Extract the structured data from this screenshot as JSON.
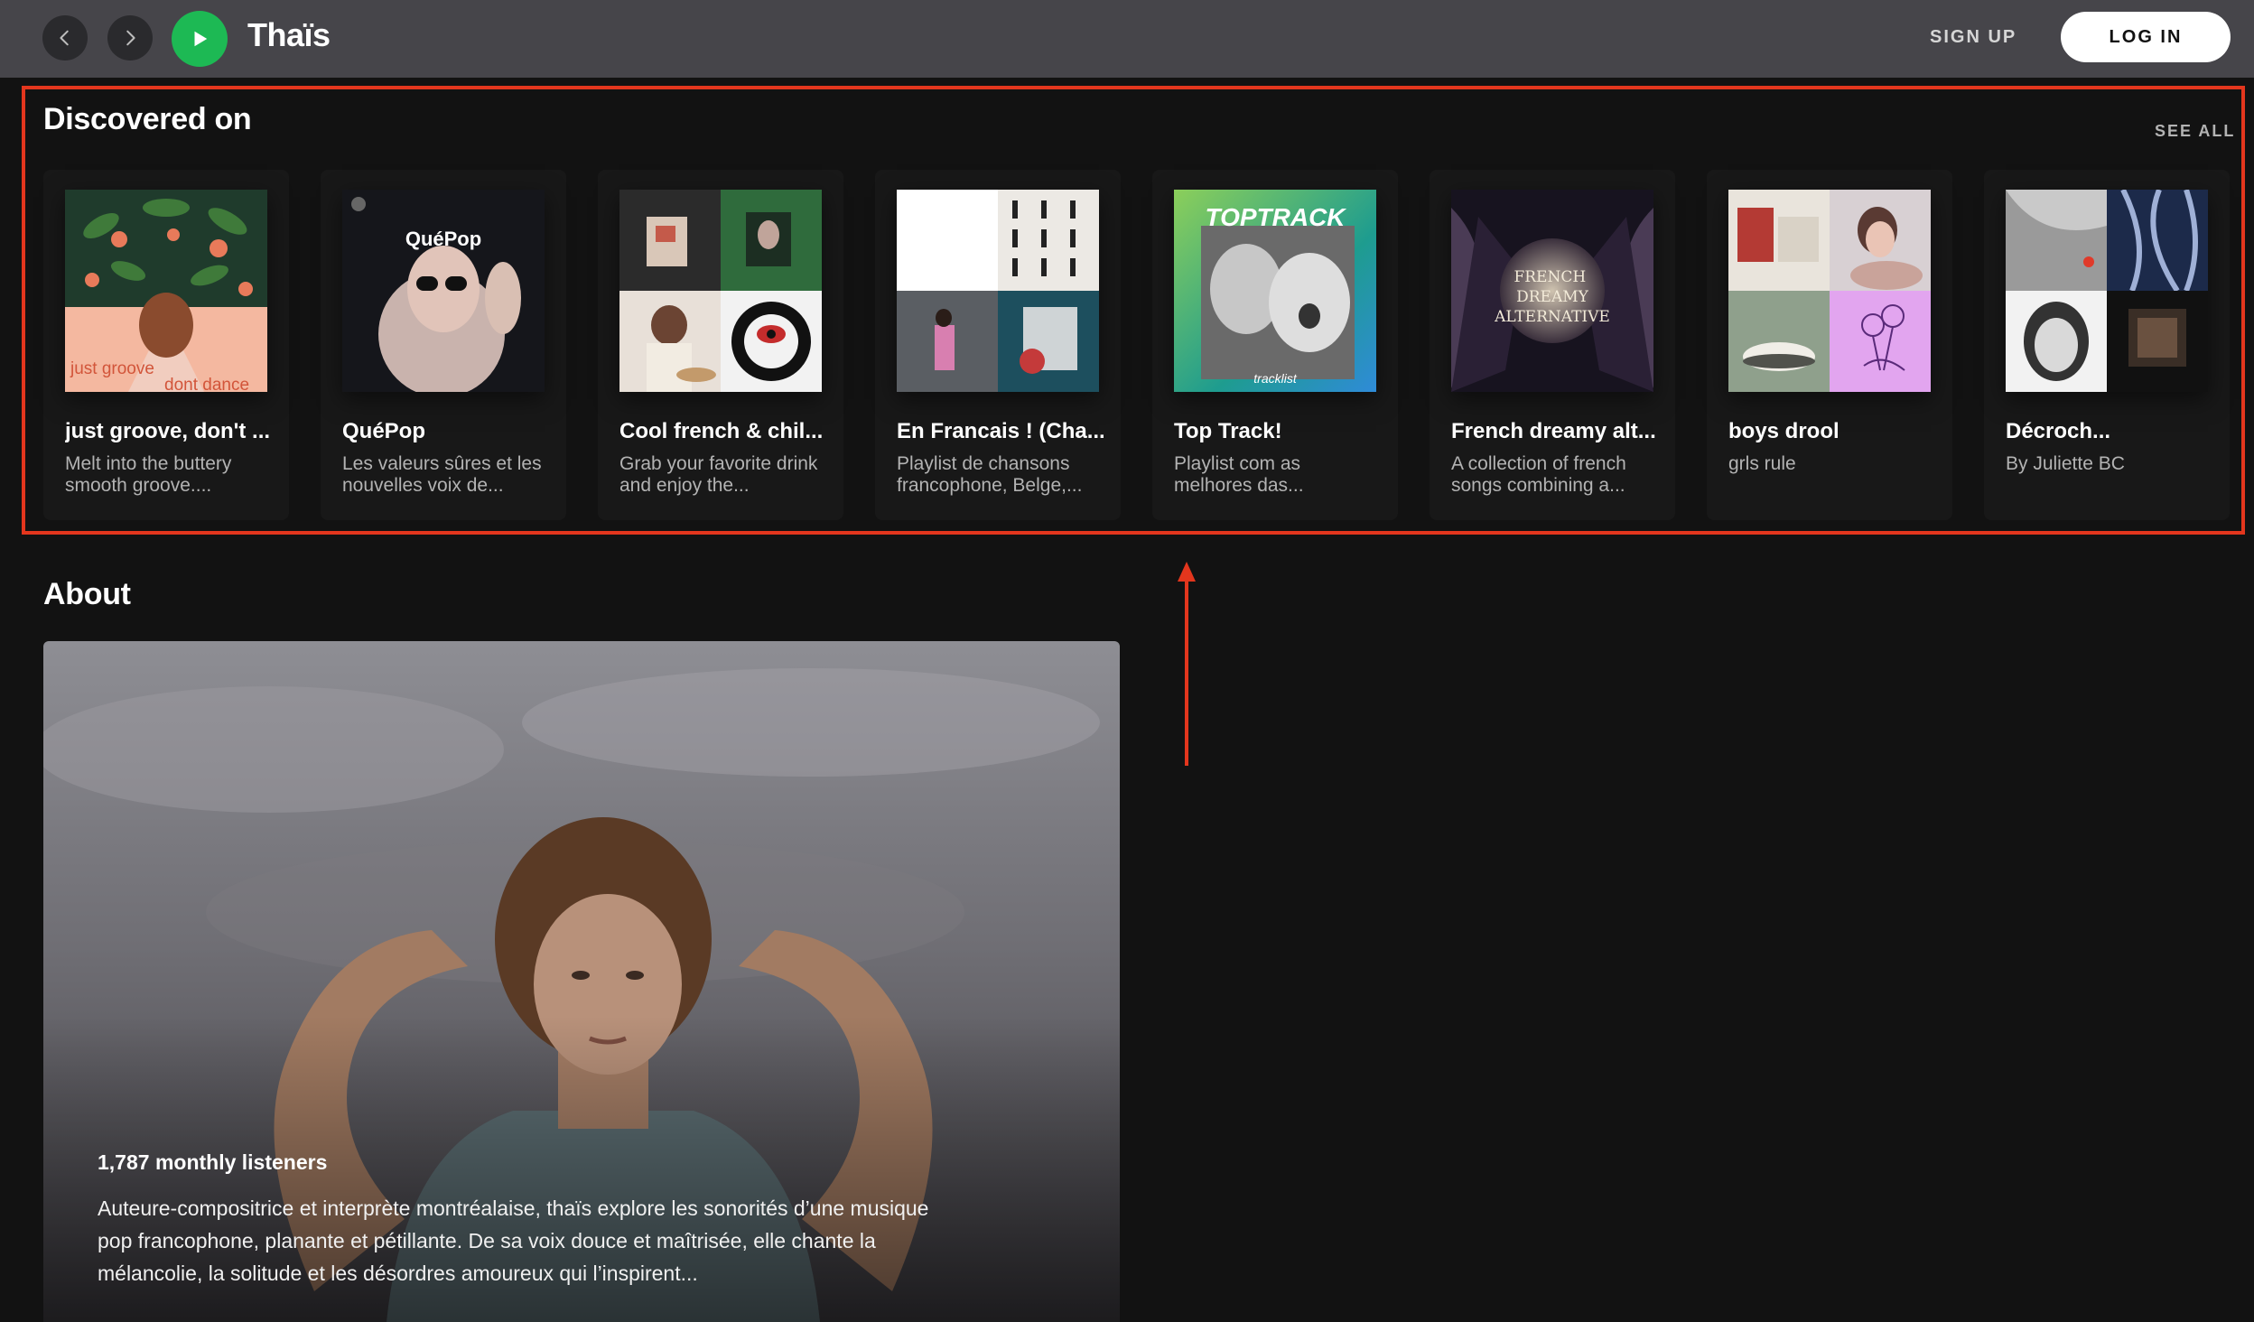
{
  "header": {
    "artist_name": "Thaïs",
    "sign_up_label": "SIGN UP",
    "log_in_label": "LOG IN"
  },
  "discovered": {
    "title": "Discovered on",
    "see_all_label": "SEE ALL",
    "cards": [
      {
        "title": "just groove, don't ...",
        "description": "Melt into the buttery smooth groove....",
        "cover_text_1": "just groove",
        "cover_text_2": "dont dance"
      },
      {
        "title": "QuéPop",
        "description": "Les valeurs sûres et les nouvelles voix de...",
        "cover_text": "QuéPop"
      },
      {
        "title": "Cool french & chil...",
        "description": "Grab your favorite drink and enjoy the..."
      },
      {
        "title": "En Francais ! (Cha...",
        "description": "Playlist de chansons francophone, Belge,..."
      },
      {
        "title": "Top Track!",
        "description": "Playlist com as melhores das...",
        "cover_text": "TOPTRACK",
        "cover_subtext": "tracklist"
      },
      {
        "title": "French dreamy alt...",
        "description": "A collection of french songs combining a...",
        "cover_text": "FRENCH DREAMY ALTERNATIVE"
      },
      {
        "title": "boys drool",
        "description": "grls rule"
      },
      {
        "title": "Décroch...",
        "description": "By Juliette BC"
      }
    ]
  },
  "about": {
    "title": "About",
    "monthly_listeners": "1,787 monthly listeners",
    "bio": "Auteure-compositrice et interprète montréalaise, thaïs explore les sonorités d’une musique pop francophone, planante et pétillante. De sa voix douce et maîtrisée, elle chante la mélancolie, la solitude et les désordres amoureux qui l’inspirent..."
  },
  "colors": {
    "accent_green": "#1db954",
    "highlight_red": "#e3361d",
    "background": "#121212",
    "topbar": "#46454a"
  }
}
